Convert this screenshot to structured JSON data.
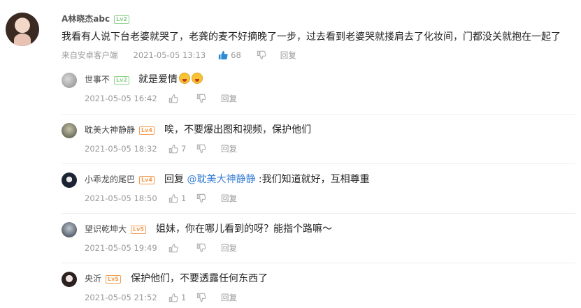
{
  "main": {
    "username": "A林晓杰abc",
    "level": "Lv2",
    "text": "我看有人说下台老婆就哭了，老龚的麦不好摘晚了一步，过去看到老婆哭就搂肩去了化妆间，门都没关就抱在一起了",
    "source": "来自安卓客户端",
    "time": "2021-05-05 13:13",
    "likes": "68",
    "reply_label": "回复"
  },
  "replies": [
    {
      "username": "世事不",
      "level": "Lv2",
      "text": "就是爱情",
      "time": "2021-05-05 16:42",
      "likes": "",
      "reply_label": "回复"
    },
    {
      "username": "耽美大神静静",
      "level": "Lv4",
      "text": "唉，不要爆出图和视频，保护他们",
      "time": "2021-05-05 18:32",
      "likes": "7",
      "reply_label": "回复"
    },
    {
      "username": "小乖龙的尾巴",
      "level": "Lv4",
      "text_prefix": "回复 ",
      "mention": "@耽美大神静静",
      "text": " :我们知道就好，互相尊重",
      "time": "2021-05-05 18:50",
      "likes": "1",
      "reply_label": "回复"
    },
    {
      "username": "望识乾坤大",
      "level": "Lv5",
      "text": "姐妹，你在哪儿看到的呀？能指个路嘛～",
      "time": "2021-05-05 19:49",
      "likes": "",
      "reply_label": "回复"
    },
    {
      "username": "央沂",
      "level": "Lv5",
      "text": "保护他们，不要透露任何东西了",
      "time": "2021-05-05 21:52",
      "likes": "1",
      "reply_label": "回复"
    }
  ],
  "colors": {
    "like_active": "#2a8ad4",
    "icon_gray": "#aaaaaa",
    "mention": "#3a7fd5",
    "level_green": "#8ed18d",
    "level_orange": "#f39c50"
  }
}
